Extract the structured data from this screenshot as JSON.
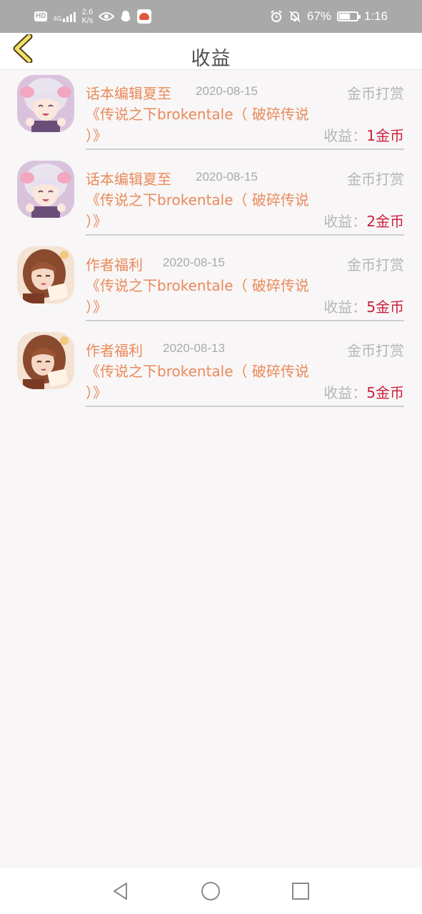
{
  "status_bar": {
    "hd": "HD",
    "network_type": "4G",
    "speed_value": "2.6",
    "speed_unit": "K/s",
    "battery_percent": "67%",
    "battery_level": 0.67,
    "time": "1:16"
  },
  "header": {
    "title": "收益"
  },
  "items": [
    {
      "author": "话本编辑夏至",
      "date": "2020-08-15",
      "type": "金币打赏",
      "book_title": "《传说之下brokentale（ 破碎传说 ）》",
      "income_label": "收益：",
      "income_value": "1金币",
      "avatar": "anime-girl-white-hair"
    },
    {
      "author": "话本编辑夏至",
      "date": "2020-08-15",
      "type": "金币打赏",
      "book_title": "《传说之下brokentale（ 破碎传说 ）》",
      "income_label": "收益：",
      "income_value": "2金币",
      "avatar": "anime-girl-white-hair"
    },
    {
      "author": "作者福利",
      "date": "2020-08-15",
      "type": "金币打赏",
      "book_title": "《传说之下brokentale（ 破碎传说 ）》",
      "income_label": "收益：",
      "income_value": "5金币",
      "avatar": "anime-girl-brown-hair"
    },
    {
      "author": "作者福利",
      "date": "2020-08-13",
      "type": "金币打赏",
      "book_title": "《传说之下brokentale（ 破碎传说 ）》",
      "income_label": "收益：",
      "income_value": "5金币",
      "avatar": "anime-girl-brown-hair"
    }
  ],
  "colors": {
    "accent": "#e98a59",
    "income_value": "#cc1f3a",
    "muted": "#b5b5b5",
    "status_bar": "#a9a9a9"
  },
  "nav_bar": {
    "back": "back-triangle-icon",
    "home": "home-circle-icon",
    "recents": "recents-square-icon"
  }
}
